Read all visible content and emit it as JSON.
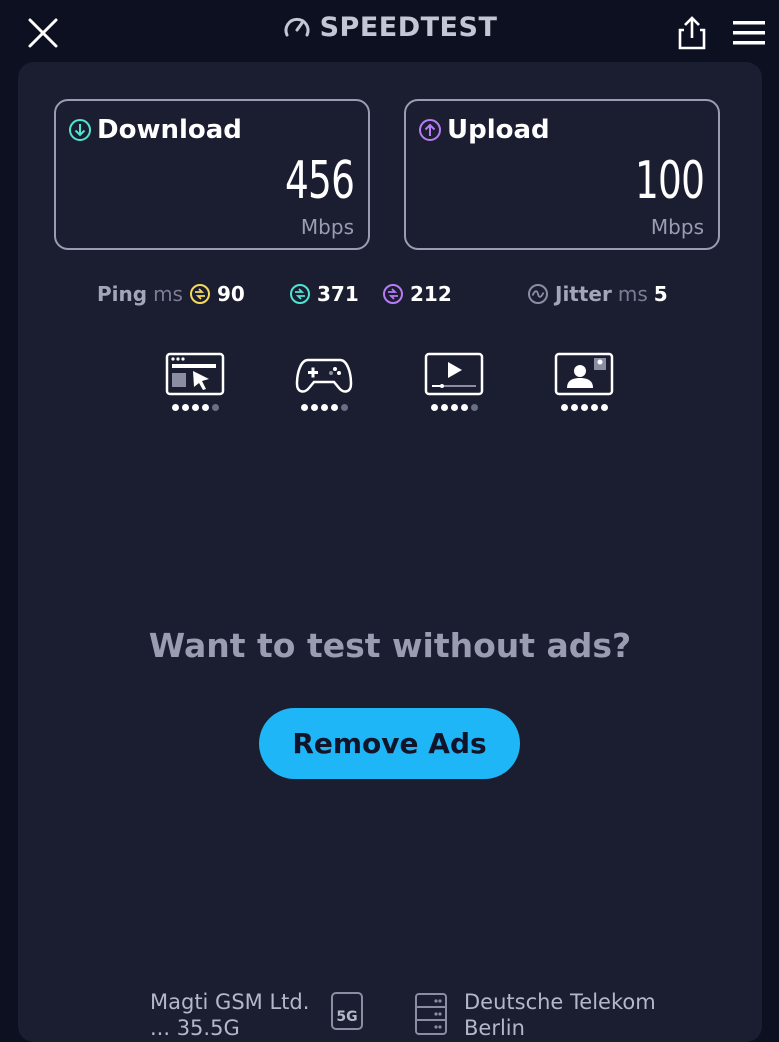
{
  "header": {
    "brand": "SPEEDTEST",
    "icons": {
      "close": "close-icon",
      "share": "share-icon",
      "menu": "hamburger-menu-icon",
      "logo": "speedometer-logo-icon"
    }
  },
  "results": {
    "download": {
      "label": "Download",
      "value": "456",
      "unit": "Mbps",
      "icon": "download-arrow-icon",
      "color": "#4fe3d3"
    },
    "upload": {
      "label": "Upload",
      "value": "100",
      "unit": "Mbps",
      "icon": "upload-arrow-icon",
      "color": "#b67cf4"
    }
  },
  "metrics": {
    "ping_label": "Ping",
    "ping_unit": "ms",
    "ping_idle": "90",
    "ping_download": "371",
    "ping_upload": "212",
    "jitter_label": "Jitter",
    "jitter_unit": "ms",
    "jitter_value": "5",
    "colors": {
      "idle": "#f5d95a",
      "download": "#4fe3d3",
      "upload": "#b67cf4"
    }
  },
  "use_cases": [
    {
      "icon": "web-browsing-icon",
      "rating": 4,
      "max": 5
    },
    {
      "icon": "gaming-controller-icon",
      "rating": 4,
      "max": 5
    },
    {
      "icon": "video-streaming-icon",
      "rating": 4,
      "max": 5
    },
    {
      "icon": "video-call-icon",
      "rating": 5,
      "max": 5
    }
  ],
  "promo": {
    "text": "Want to test without ads?",
    "button_label": "Remove Ads",
    "button_color": "#1fb6f8"
  },
  "footer": {
    "provider_name": "Magti GSM Ltd.",
    "provider_sub": "... 35.5G",
    "network_badge": "5G",
    "server_name": "Deutsche Telekom",
    "server_location": "Berlin"
  }
}
